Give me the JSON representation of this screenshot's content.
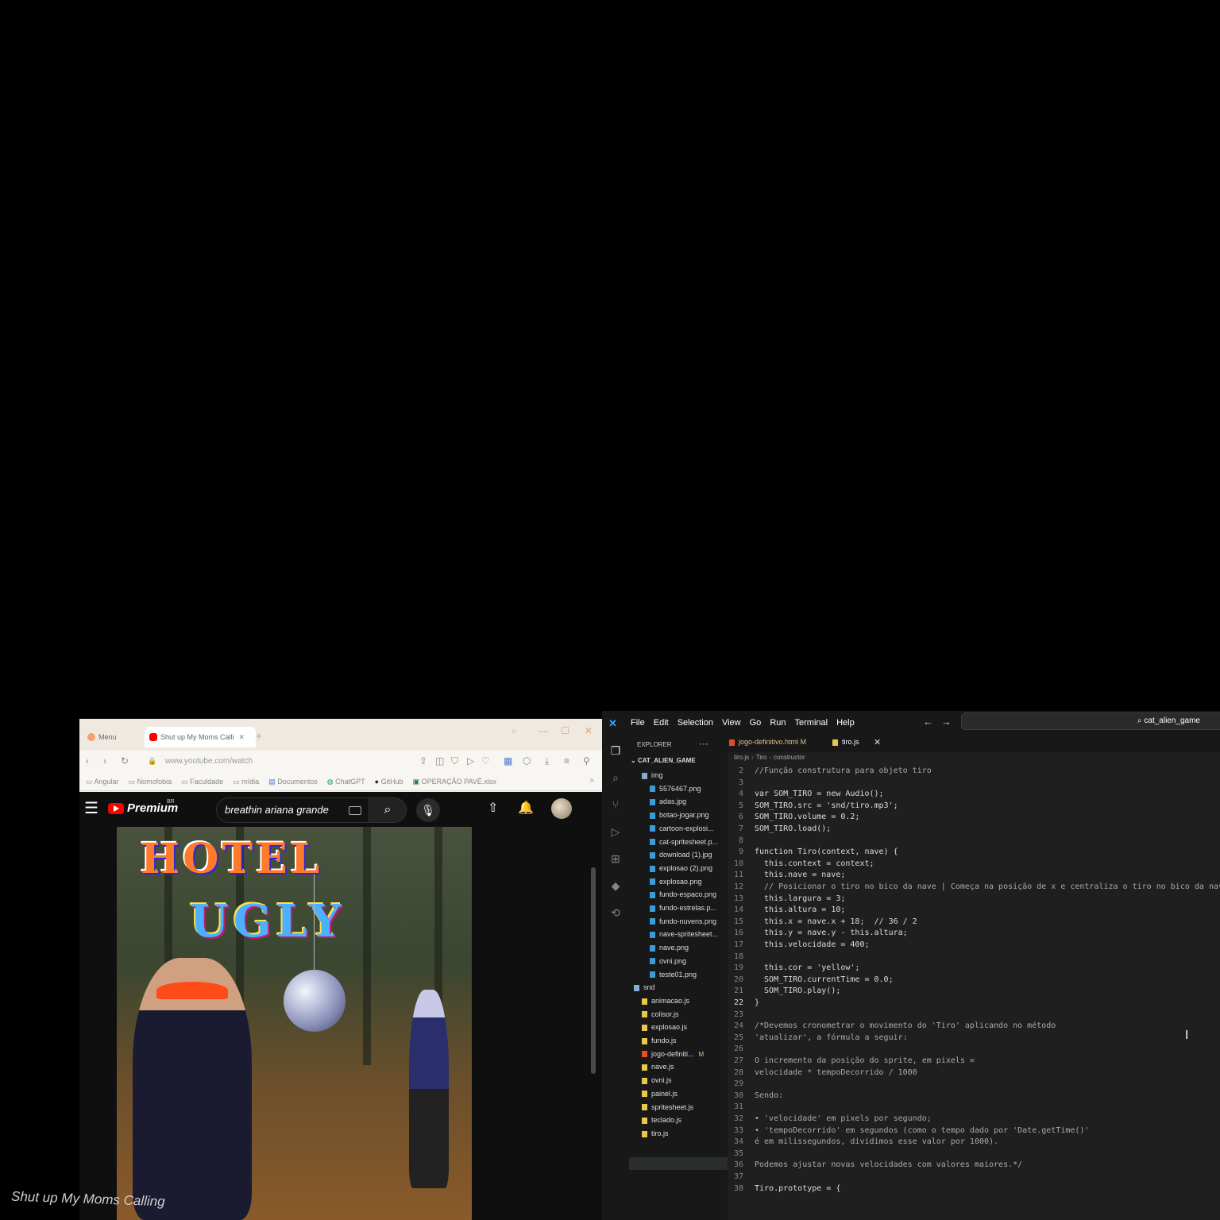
{
  "browser": {
    "tabs": [
      {
        "label": "Menu"
      },
      {
        "label": "Shut up My Moms Calli"
      }
    ],
    "new_tab": "+",
    "address": "www.youtube.com/watch",
    "bookmarks": [
      "Angular",
      "Nomofobia",
      "Faculdade",
      "mídia",
      "Documentos",
      "ChatGPT",
      "GitHub",
      "OPERAÇÃO PAVÊ.xlsx"
    ],
    "bookmarks_more": "»"
  },
  "youtube": {
    "brand": "Premium",
    "region": "BR",
    "search_value": "breathin ariana grande",
    "video_title_line1": "HOTEL",
    "video_title_line2": "UGLY",
    "caption": "Shut up My Moms Calling"
  },
  "vscode": {
    "menu": [
      "File",
      "Edit",
      "Selection",
      "View",
      "Go",
      "Run",
      "Terminal",
      "Help"
    ],
    "command_center": "cat_alien_game",
    "explorer_title": "EXPLORER",
    "explorer_more": "···",
    "project": "CAT_ALIEN_GAME",
    "tree": [
      {
        "name": "img",
        "type": "folder",
        "indent": 1
      },
      {
        "name": "5576467.png",
        "type": "png",
        "indent": 2
      },
      {
        "name": "adas.jpg",
        "type": "png",
        "indent": 2
      },
      {
        "name": "botao-jogar.png",
        "type": "png",
        "indent": 2
      },
      {
        "name": "cartoon-explosi...",
        "type": "png",
        "indent": 2
      },
      {
        "name": "cat-spritesheet.p...",
        "type": "png",
        "indent": 2
      },
      {
        "name": "download (1).jpg",
        "type": "png",
        "indent": 2
      },
      {
        "name": "explosao (2).png",
        "type": "png",
        "indent": 2
      },
      {
        "name": "explosao.png",
        "type": "png",
        "indent": 2
      },
      {
        "name": "fundo-espaco.png",
        "type": "png",
        "indent": 2
      },
      {
        "name": "fundo-estrelas.p...",
        "type": "png",
        "indent": 2
      },
      {
        "name": "fundo-nuvens.png",
        "type": "png",
        "indent": 2
      },
      {
        "name": "nave-spritesheet...",
        "type": "png",
        "indent": 2
      },
      {
        "name": "nave.png",
        "type": "png",
        "indent": 2
      },
      {
        "name": "ovni.png",
        "type": "png",
        "indent": 2
      },
      {
        "name": "teste01.png",
        "type": "png",
        "indent": 2
      },
      {
        "name": "snd",
        "type": "folder",
        "indent": 0
      },
      {
        "name": "animacao.js",
        "type": "js",
        "indent": 1
      },
      {
        "name": "colisor.js",
        "type": "js",
        "indent": 1
      },
      {
        "name": "explosao.js",
        "type": "js",
        "indent": 1
      },
      {
        "name": "fundo.js",
        "type": "js",
        "indent": 1
      },
      {
        "name": "jogo-definiti...",
        "type": "html",
        "indent": 1,
        "badge": "M"
      },
      {
        "name": "nave.js",
        "type": "js",
        "indent": 1
      },
      {
        "name": "ovni.js",
        "type": "js",
        "indent": 1
      },
      {
        "name": "painel.js",
        "type": "js",
        "indent": 1
      },
      {
        "name": "spritesheet.js",
        "type": "js",
        "indent": 1
      },
      {
        "name": "teclado.js",
        "type": "js",
        "indent": 1
      },
      {
        "name": "tiro.js",
        "type": "js",
        "indent": 1
      }
    ],
    "editor_tabs": [
      {
        "label": "jogo-definitivo.html",
        "badge": "M"
      },
      {
        "label": "tiro.js"
      }
    ],
    "tab_close": "✕",
    "breadcrumb": [
      "tiro.js",
      "Tiro",
      "constructor"
    ],
    "code": [
      {
        "n": "2",
        "t": "//Função construtura para objeto tiro",
        "c": "cmt"
      },
      {
        "n": "3",
        "t": ""
      },
      {
        "n": "4",
        "t": "var SOM_TIRO = new Audio();"
      },
      {
        "n": "5",
        "t": "SOM_TIRO.src = 'snd/tiro.mp3';"
      },
      {
        "n": "6",
        "t": "SOM_TIRO.volume = 0.2;"
      },
      {
        "n": "7",
        "t": "SOM_TIRO.load();"
      },
      {
        "n": "8",
        "t": ""
      },
      {
        "n": "9",
        "t": "function Tiro(context, nave) {"
      },
      {
        "n": "10",
        "t": "  this.context = context;"
      },
      {
        "n": "11",
        "t": "  this.nave = nave;"
      },
      {
        "n": "12",
        "t": "  // Posicionar o tiro no bico da nave | Começa na posição de x e centraliza o tiro no bico da nave",
        "c": "cmt"
      },
      {
        "n": "13",
        "t": "  this.largura = 3;"
      },
      {
        "n": "14",
        "t": "  this.altura = 10;"
      },
      {
        "n": "15",
        "t": "  this.x = nave.x + 18;  // 36 / 2"
      },
      {
        "n": "16",
        "t": "  this.y = nave.y - this.altura;"
      },
      {
        "n": "17",
        "t": "  this.velocidade = 400;"
      },
      {
        "n": "18",
        "t": ""
      },
      {
        "n": "19",
        "t": "  this.cor = 'yellow';"
      },
      {
        "n": "20",
        "t": "  SOM_TIRO.currentTime = 0.0;"
      },
      {
        "n": "21",
        "t": "  SOM_TIRO.play();"
      },
      {
        "n": "22",
        "t": "}",
        "current": true
      },
      {
        "n": "23",
        "t": ""
      },
      {
        "n": "24",
        "t": "/*Devemos cronometrar o movimento do 'Tiro' aplicando no método",
        "c": "cmt"
      },
      {
        "n": "25",
        "t": "'atualizar', a fórmula a seguir:",
        "c": "cmt"
      },
      {
        "n": "26",
        "t": ""
      },
      {
        "n": "27",
        "t": "O incremento da posição do sprite, em pixels =",
        "c": "cmt"
      },
      {
        "n": "28",
        "t": "velocidade * tempoDecorrido / 1000",
        "c": "cmt"
      },
      {
        "n": "29",
        "t": ""
      },
      {
        "n": "30",
        "t": "Sendo:",
        "c": "cmt"
      },
      {
        "n": "31",
        "t": ""
      },
      {
        "n": "32",
        "t": "• 'velocidade' em pixels por segundo;",
        "c": "cmt"
      },
      {
        "n": "33",
        "t": "• 'tempoDecorrido' em segundos (como o tempo dado por 'Date.getTime()'",
        "c": "cmt"
      },
      {
        "n": "34",
        "t": "é em milissegundos, dividimos esse valor por 1000).",
        "c": "cmt"
      },
      {
        "n": "35",
        "t": ""
      },
      {
        "n": "36",
        "t": "Podemos ajustar novas velocidades com valores maiores.*/",
        "c": "cmt"
      },
      {
        "n": "37",
        "t": ""
      },
      {
        "n": "38",
        "t": "Tiro.prototype = {"
      }
    ]
  },
  "colors": {
    "accent": "#3aa0ff",
    "yt_red": "#ff0000"
  }
}
